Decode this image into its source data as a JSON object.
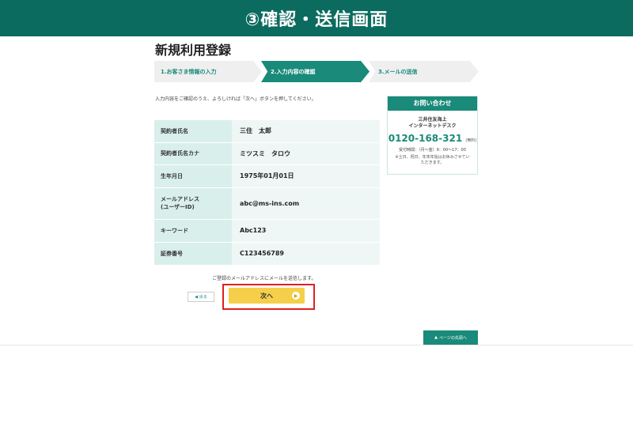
{
  "banner": {
    "title": "③確認・送信画面"
  },
  "page": {
    "title": "新規利用登録"
  },
  "steps": [
    {
      "label": "1.お客さま情報の入力"
    },
    {
      "label": "2.入力内容の確認"
    },
    {
      "label": "3.メールの送信"
    }
  ],
  "instruction": "入力内容をご確認のうえ、よろしければ「次へ」ボタンを押してください。",
  "rows": [
    {
      "label": "契約者氏名",
      "value": "三住　太郎"
    },
    {
      "label": "契約者氏名カナ",
      "value": "ミツスミ　タロウ"
    },
    {
      "label": "生年月日",
      "value": "1975年01月01日"
    },
    {
      "label_line1": "メールアドレス",
      "label_line2": "(ユーザーID)",
      "value": "abc@ms-ins.com"
    },
    {
      "label": "キーワード",
      "value": "Abc123"
    },
    {
      "label": "証券番号",
      "value": "C123456789"
    }
  ],
  "contact": {
    "title": "お問い合わせ",
    "company_line1": "三井住友海上",
    "company_line2": "インターネットデスク",
    "phone": "0120-168-321",
    "phone_note": "(無料)",
    "hours": "受付時間：（月～金）9：00～17：00",
    "note": "※土日、祝日、年末年始はお休みさせていただきます。"
  },
  "send_note": "ご登録のメールアドレスにメールを送信します。",
  "buttons": {
    "back": "戻る",
    "next": "次へ",
    "page_top": "ページの先頭へ"
  },
  "icons": {
    "back": "chevron-left-icon",
    "next": "chevron-right-icon",
    "page_top": "chevron-up-icon"
  },
  "colors": {
    "brand": "#1a8a7a",
    "banner": "#0b6b5e",
    "next_button": "#f5cf4a",
    "highlight": "#e02020"
  }
}
